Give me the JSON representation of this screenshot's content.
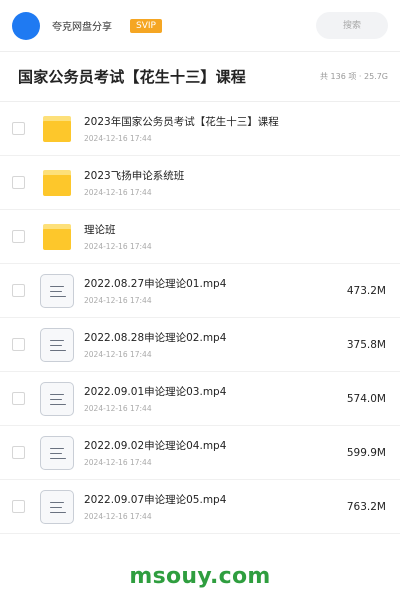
{
  "header": {
    "username": "夸克网盘分享",
    "badge": "SVIP",
    "search_placeholder": "搜索"
  },
  "folder": {
    "title": "国家公务员考试【花生十三】课程",
    "summary": "共 136 项 · 25.7G"
  },
  "files": [
    {
      "type": "folder",
      "name": "2023年国家公务员考试【花生十三】课程",
      "date": "2024-12-16 17:44",
      "size": ""
    },
    {
      "type": "folder",
      "name": "2023飞扬申论系统班",
      "date": "2024-12-16 17:44",
      "size": ""
    },
    {
      "type": "folder",
      "name": "理论班",
      "date": "2024-12-16 17:44",
      "size": ""
    },
    {
      "type": "file",
      "name": "2022.08.27申论理论01.mp4",
      "date": "2024-12-16 17:44",
      "size": "473.2M"
    },
    {
      "type": "file",
      "name": "2022.08.28申论理论02.mp4",
      "date": "2024-12-16 17:44",
      "size": "375.8M"
    },
    {
      "type": "file",
      "name": "2022.09.01申论理论03.mp4",
      "date": "2024-12-16 17:44",
      "size": "574.0M"
    },
    {
      "type": "file",
      "name": "2022.09.02申论理论04.mp4",
      "date": "2024-12-16 17:44",
      "size": "599.9M"
    },
    {
      "type": "file",
      "name": "2022.09.07申论理论05.mp4",
      "date": "2024-12-16 17:44",
      "size": "763.2M"
    }
  ],
  "icons": {
    "folder": "folder-icon",
    "file": "document-icon"
  },
  "colors": {
    "accent": "#1f7af2",
    "badge": "#f5a623",
    "folder": "#fdc72b",
    "watermark": "#2f9e3f"
  },
  "watermark": "msouy.com"
}
